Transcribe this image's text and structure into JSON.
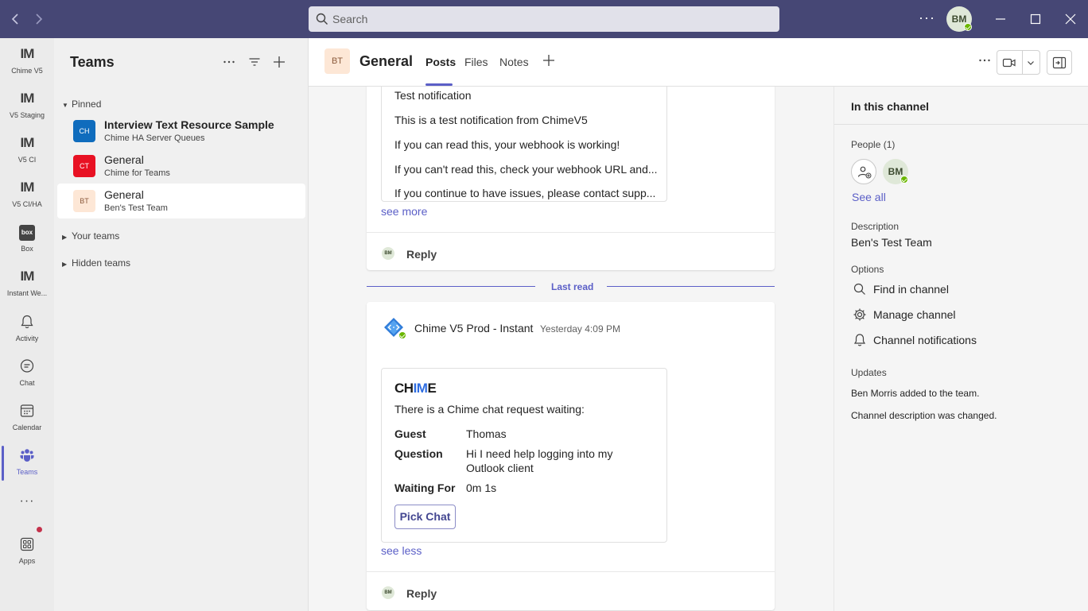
{
  "titlebar": {
    "search_placeholder": "Search",
    "user_initials": "BM",
    "more": "···"
  },
  "rail": {
    "items": [
      {
        "label": "Chime V5",
        "icon": "im-logo"
      },
      {
        "label": "V5 Staging",
        "icon": "im-logo"
      },
      {
        "label": "V5 CI",
        "icon": "im-logo"
      },
      {
        "label": "V5 CI/HA",
        "icon": "im-logo"
      },
      {
        "label": "Box",
        "icon": "box-logo"
      },
      {
        "label": "Instant We...",
        "icon": "im-logo"
      },
      {
        "label": "Activity",
        "icon": "bell-icon"
      },
      {
        "label": "Chat",
        "icon": "chat-icon"
      },
      {
        "label": "Calendar",
        "icon": "calendar-icon"
      },
      {
        "label": "Teams",
        "icon": "teams-icon"
      },
      {
        "label": "Apps",
        "icon": "apps-icon"
      }
    ],
    "logo_text": "IM",
    "box_text": "box",
    "more": "···",
    "active": "Teams"
  },
  "teams_pane": {
    "title": "Teams",
    "pinned_label": "Pinned",
    "pinned": [
      {
        "tile": "CH",
        "name": "Interview Text Resource Sample",
        "team": "Chime HA Server Queues",
        "tile_bg": "#0f6cbd",
        "tile_fg": "#ffffff",
        "bold": true
      },
      {
        "tile": "CT",
        "name": "General",
        "team": "Chime for Teams",
        "tile_bg": "#e81123",
        "tile_fg": "#ffffff",
        "bold": false
      },
      {
        "tile": "BT",
        "name": "General",
        "team": "Ben's Test Team",
        "tile_bg": "#fde7d6",
        "tile_fg": "#8a5a3c",
        "bold": false
      }
    ],
    "your_teams_label": "Your teams",
    "hidden_teams_label": "Hidden teams"
  },
  "channel_header": {
    "tile": "BT",
    "title": "General",
    "tabs": [
      "Posts",
      "Files",
      "Notes"
    ],
    "active_tab": "Posts",
    "more": "···"
  },
  "posts": {
    "first_card": {
      "lines": [
        "Test notification",
        "This is a test notification from ChimeV5",
        "If you can read this, your webhook is working!",
        "If you can't read this, check your webhook URL and...",
        "If you continue to have issues, please contact supp..."
      ],
      "see_more": "see more",
      "reply": "Reply",
      "reply_initials": "BM"
    },
    "last_read": "Last read",
    "second_card": {
      "sender": "Chime V5 Prod - Instant",
      "time": "Yesterday 4:09 PM",
      "logo_a": "CH",
      "logo_b": "IM",
      "logo_c": "E",
      "intro": "There is a Chime chat request waiting:",
      "fields": [
        {
          "key": "Guest",
          "value": "Thomas"
        },
        {
          "key": "Question",
          "value": "Hi I need help logging into my Outlook client"
        },
        {
          "key": "Waiting For",
          "value": "0m 1s"
        }
      ],
      "button": "Pick Chat",
      "see_less": "see less",
      "reply": "Reply",
      "reply_initials": "BM"
    }
  },
  "info_pane": {
    "title": "In this channel",
    "people_label": "People (1)",
    "person_initials": "BM",
    "see_all": "See all",
    "description_label": "Description",
    "description": "Ben's Test Team",
    "options_label": "Options",
    "options": [
      "Find in channel",
      "Manage channel",
      "Channel notifications"
    ],
    "updates_label": "Updates",
    "updates": [
      "Ben Morris added  to the team.",
      "Channel description was changed."
    ]
  },
  "colors": {
    "titlebar": "#464775",
    "accent": "#5b5fc7",
    "presence": "#6bb700"
  }
}
